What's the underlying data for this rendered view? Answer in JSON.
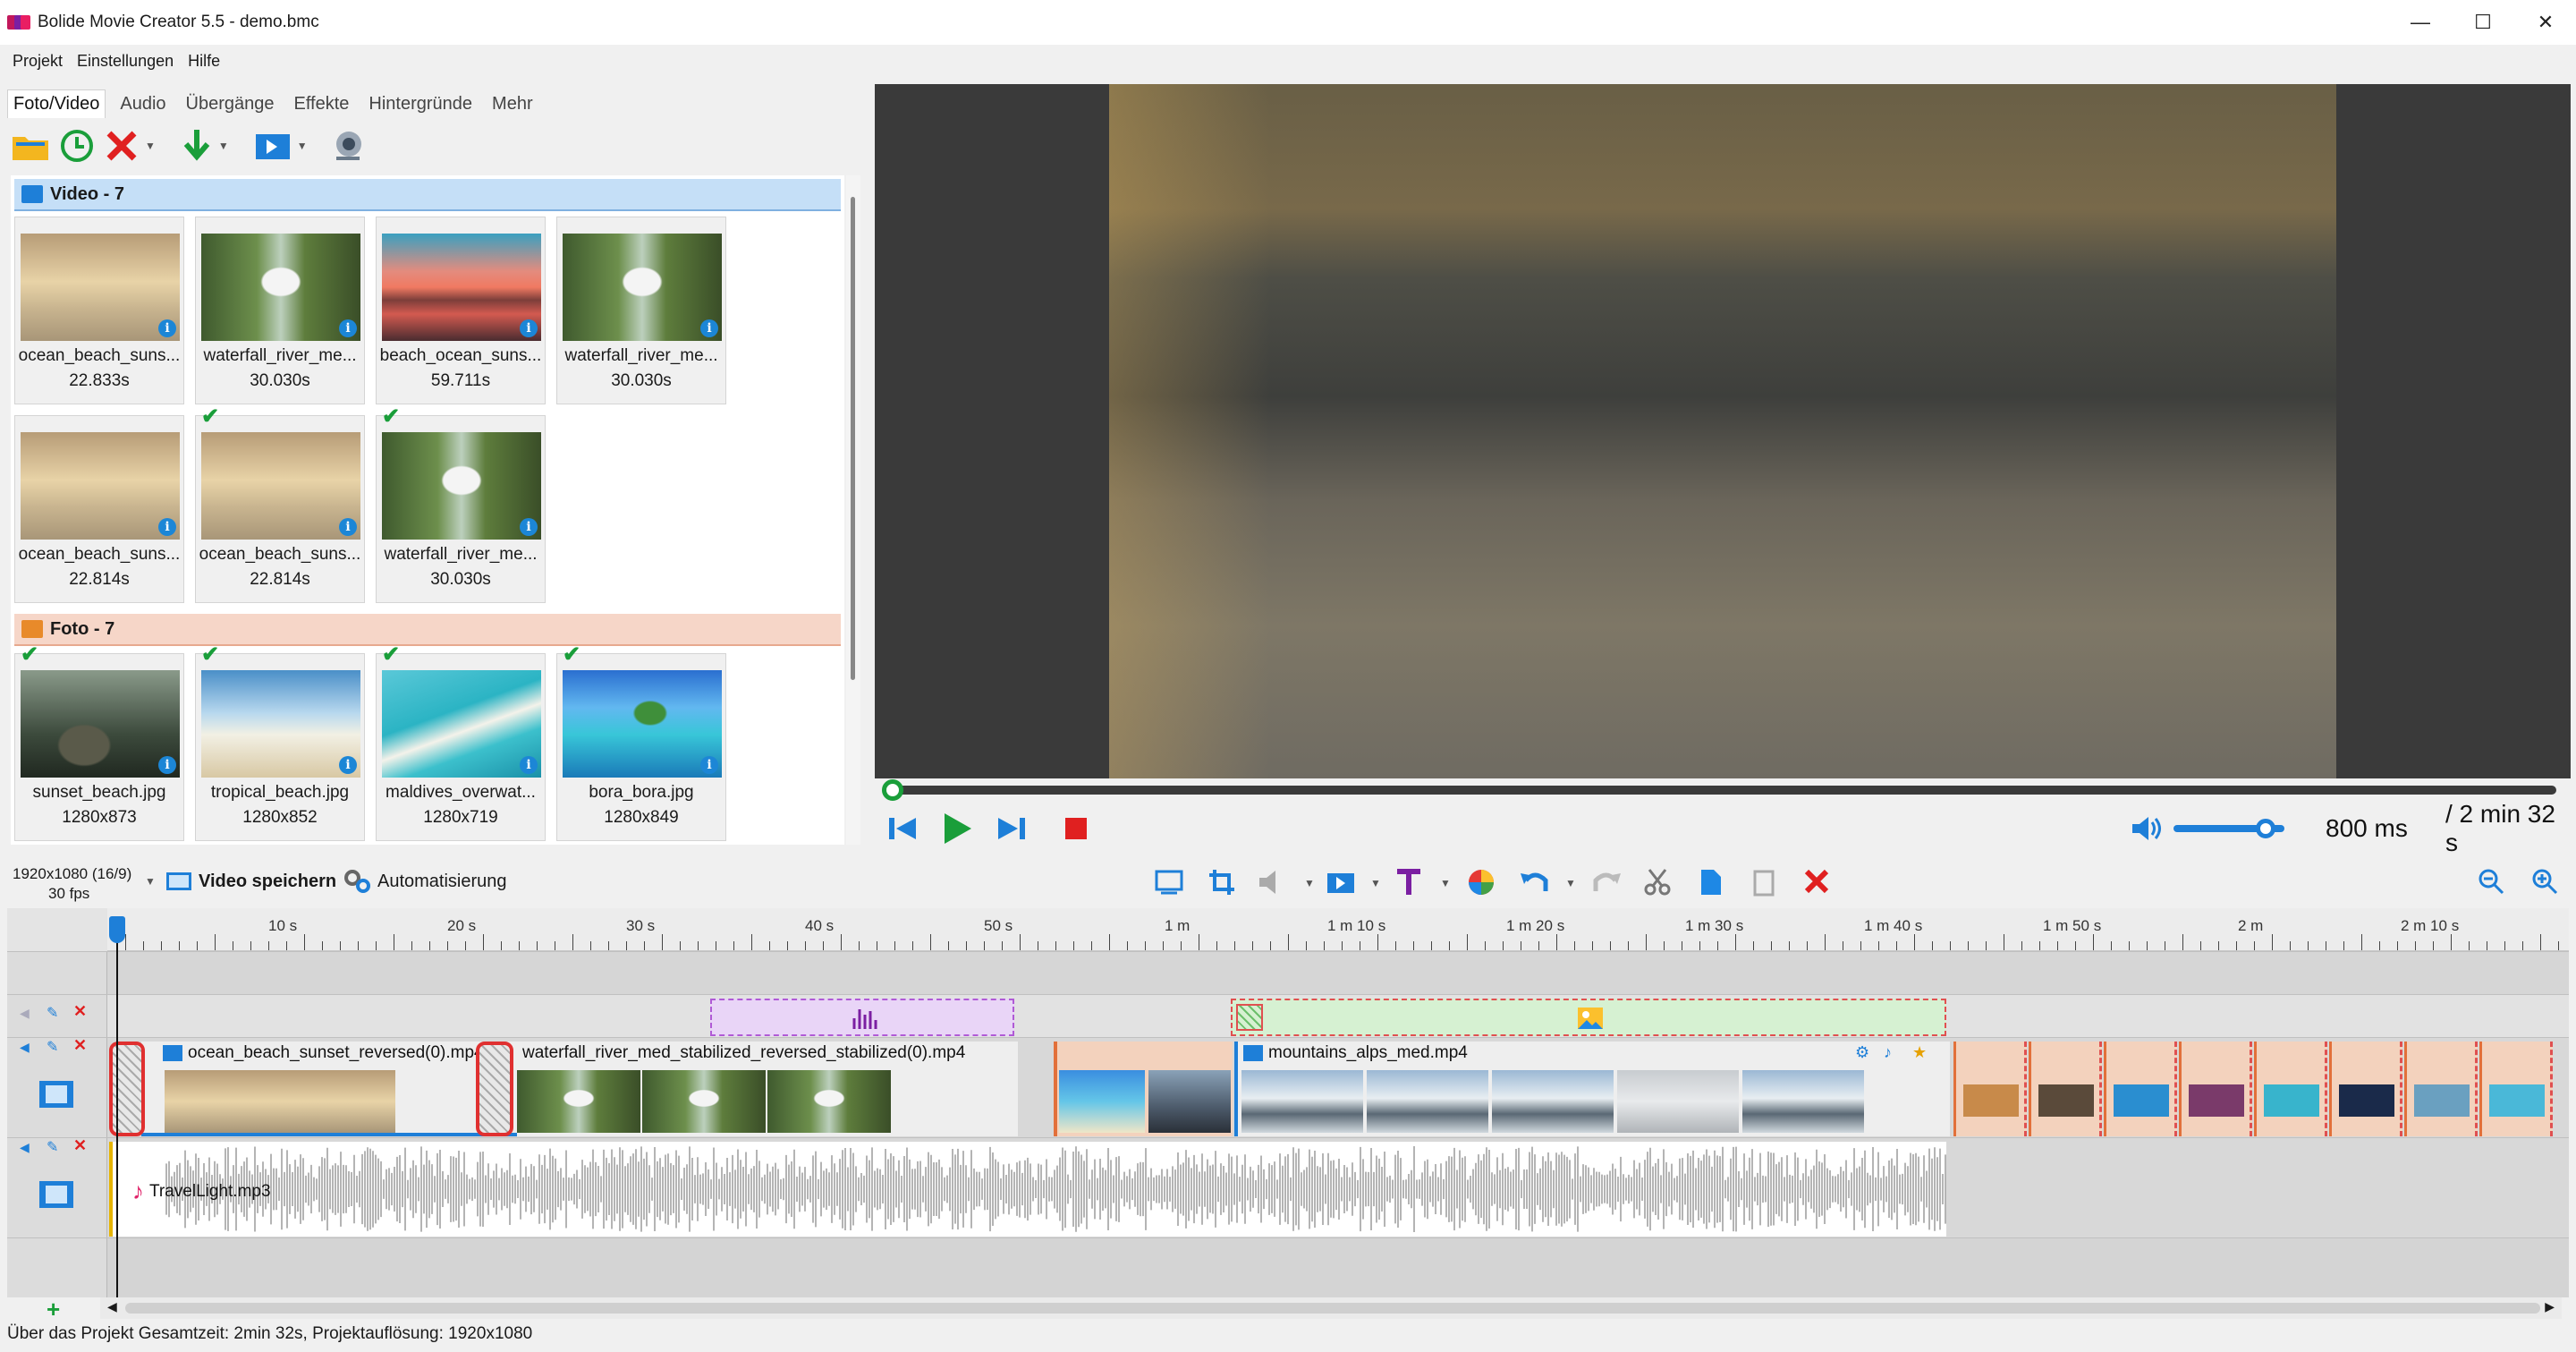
{
  "window": {
    "title": "Bolide Movie Creator 5.5 - demo.bmc",
    "minimize": "—",
    "maximize": "☐",
    "close": "✕"
  },
  "menu": [
    "Projekt",
    "Einstellungen",
    "Hilfe"
  ],
  "tabs": [
    "Foto/Video",
    "Audio",
    "Übergänge",
    "Effekte",
    "Hintergründe",
    "Mehr"
  ],
  "media": {
    "video_group": "Video - 7",
    "videos": [
      {
        "name": "ocean_beach_suns...",
        "duration": "22.833s",
        "checked": false
      },
      {
        "name": "waterfall_river_me...",
        "duration": "30.030s",
        "checked": false
      },
      {
        "name": "beach_ocean_suns...",
        "duration": "59.711s",
        "checked": false
      },
      {
        "name": "waterfall_river_me...",
        "duration": "30.030s",
        "checked": false
      },
      {
        "name": "ocean_beach_suns...",
        "duration": "22.814s",
        "checked": false
      },
      {
        "name": "ocean_beach_suns...",
        "duration": "22.814s",
        "checked": true
      },
      {
        "name": "waterfall_river_me...",
        "duration": "30.030s",
        "checked": true
      }
    ],
    "photo_group": "Foto - 7",
    "photos": [
      {
        "name": "sunset_beach.jpg",
        "duration": "1280x873",
        "checked": true
      },
      {
        "name": "tropical_beach.jpg",
        "duration": "1280x852",
        "checked": true
      },
      {
        "name": "maldives_overwat...",
        "duration": "1280x719",
        "checked": true
      },
      {
        "name": "bora_bora.jpg",
        "duration": "1280x849",
        "checked": true
      }
    ],
    "info_glyph": "i"
  },
  "player": {
    "position": "800 ms",
    "total": "/ 2 min 32 s",
    "seek_fraction": 0.0,
    "volume_fraction": 0.85
  },
  "bar": {
    "resolution": "1920x1080 (16/9)",
    "fps": "30 fps",
    "save_label": "Video speichern",
    "auto_label": "Automatisierung"
  },
  "ruler": {
    "labels": [
      "10 s",
      "20 s",
      "30 s",
      "40 s",
      "50 s",
      "1 m",
      "1 m 10 s",
      "1 m 20 s",
      "1 m 30 s",
      "1 m 40 s",
      "1 m 50 s",
      "2 m",
      "2 m 10 s"
    ]
  },
  "clips": {
    "clip1": "ocean_beach_sunset_reversed(0).mp4",
    "clip2": "waterfall_river_med_stabilized_reversed_stabilized(0).mp4",
    "clip3": "mountains_alps_med.mp4",
    "audio": "TravelLight.mp3"
  },
  "status": {
    "text": "Über das Projekt Gesamtzeit: 2min 32s,   Projektauflösung:   1920x1080"
  },
  "colors": {
    "accent": "#1e7fd8",
    "play": "#1a9e3a",
    "stop": "#e02020",
    "video_group": "#c5dff7",
    "photo_group": "#f6d6c8"
  }
}
